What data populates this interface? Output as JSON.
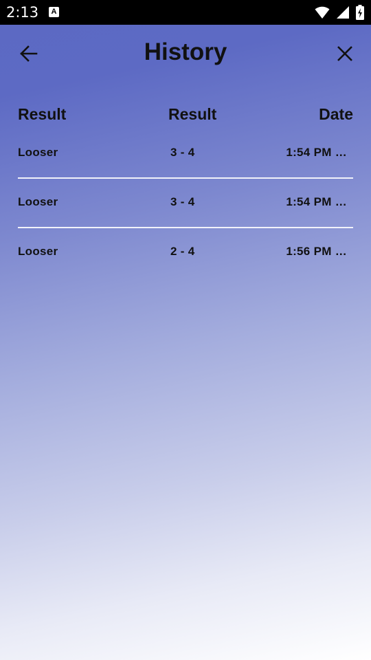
{
  "status_bar": {
    "time": "2:13",
    "notification_icon": "A"
  },
  "app_bar": {
    "title": "History",
    "back_icon": "arrow-left",
    "close_icon": "close-x"
  },
  "table": {
    "headers": [
      "Result",
      "Result",
      "Date"
    ],
    "rows": [
      {
        "result": "Looser",
        "score": "3 - 4",
        "date": "1:54 PM …"
      },
      {
        "result": "Looser",
        "score": "3 - 4",
        "date": "1:54 PM …"
      },
      {
        "result": "Looser",
        "score": "2 - 4",
        "date": "1:56 PM …"
      }
    ]
  }
}
